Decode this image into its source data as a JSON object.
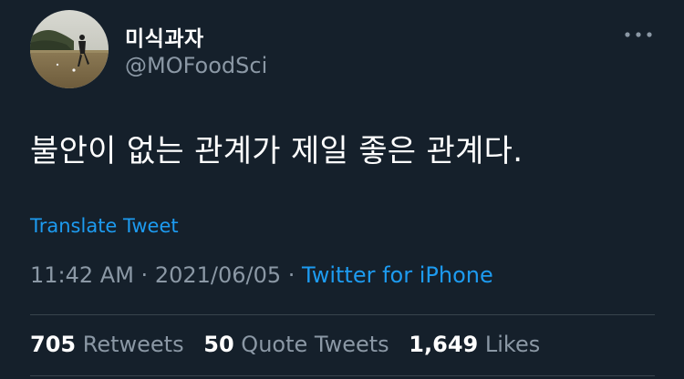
{
  "colors": {
    "background": "#15202b",
    "text_primary": "#ffffff",
    "text_secondary": "#8b98a5",
    "link": "#1d9bf0",
    "divider": "#38444d"
  },
  "author": {
    "display_name": "미식과자",
    "handle": "@MOFoodSci",
    "avatar_icon": "profile-photo"
  },
  "menu": {
    "icon": "more-horizontal-icon"
  },
  "tweet": {
    "text": "불안이 없는 관계가 제일 좋은 관계다.",
    "translate_label": "Translate Tweet"
  },
  "meta": {
    "time": "11:42 AM",
    "sep1": " · ",
    "date": "2021/06/05",
    "sep2": " · ",
    "source": "Twitter for iPhone"
  },
  "stats": {
    "retweets": {
      "count": "705",
      "label": "Retweets"
    },
    "quotes": {
      "count": "50",
      "label": "Quote Tweets"
    },
    "likes": {
      "count": "1,649",
      "label": "Likes"
    }
  }
}
